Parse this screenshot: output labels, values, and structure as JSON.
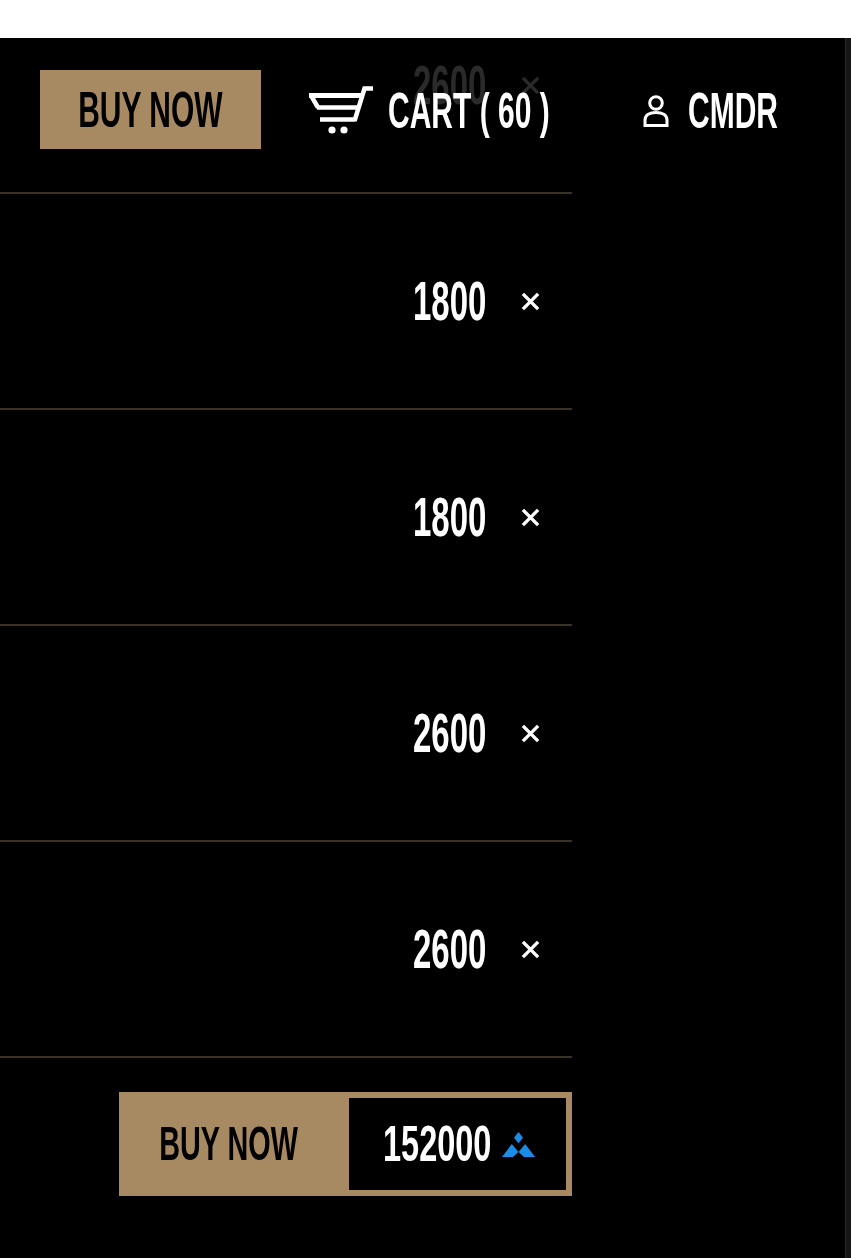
{
  "header": {
    "buy_button": "BUY NOW",
    "cart_label": "CART ( 60 )",
    "user_label": "CMDR"
  },
  "cart_items": [
    {
      "price": "2600",
      "dimmed": true
    },
    {
      "price": "1800",
      "dimmed": false
    },
    {
      "price": "1800",
      "dimmed": false
    },
    {
      "price": "2600",
      "dimmed": false
    },
    {
      "price": "2600",
      "dimmed": false
    }
  ],
  "checkout": {
    "button": "BUY NOW",
    "total": "152000"
  }
}
